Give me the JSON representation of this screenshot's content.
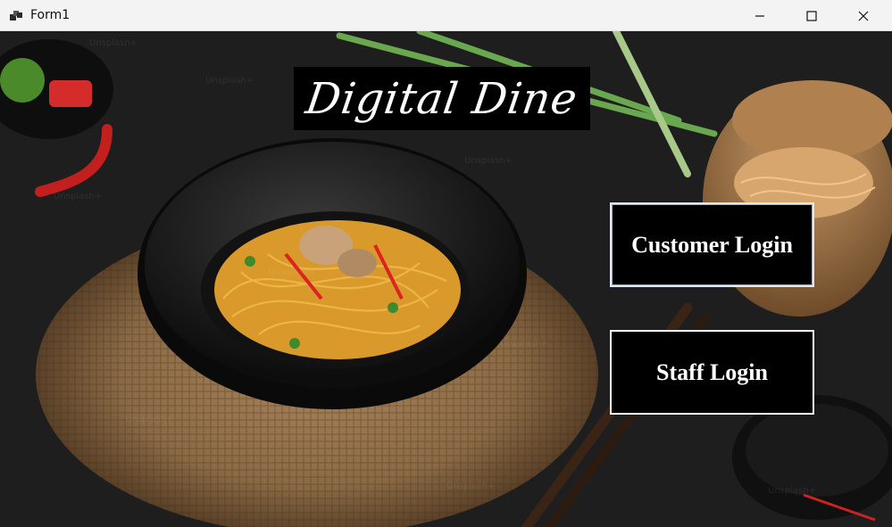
{
  "window": {
    "title": "Form1"
  },
  "controls": {
    "minimize": "minimize",
    "maximize": "maximize",
    "close": "close"
  },
  "app": {
    "logo": "Digital Dine"
  },
  "buttons": {
    "customer_login": "Customer Login",
    "staff_login": "Staff Login"
  },
  "watermark": {
    "text": "Unsplash+"
  },
  "colors": {
    "button_bg": "#000000",
    "button_text": "#ffffff",
    "titlebar": "#f3f3f3"
  }
}
